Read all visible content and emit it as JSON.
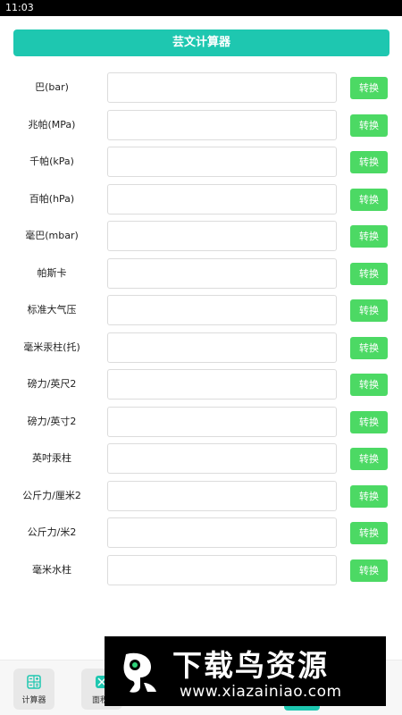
{
  "status_bar": {
    "time": "11:03"
  },
  "header": {
    "title": "芸文计算器"
  },
  "converter": {
    "button_label": "转换",
    "rows": [
      {
        "label": "巴(bar)",
        "value": ""
      },
      {
        "label": "兆帕(MPa)",
        "value": ""
      },
      {
        "label": "千帕(kPa)",
        "value": ""
      },
      {
        "label": "百帕(hPa)",
        "value": ""
      },
      {
        "label": "毫巴(mbar)",
        "value": ""
      },
      {
        "label": "帕斯卡",
        "value": ""
      },
      {
        "label": "标准大气压",
        "value": ""
      },
      {
        "label": "毫米汞柱(托)",
        "value": ""
      },
      {
        "label": "磅力/英尺2",
        "value": ""
      },
      {
        "label": "磅力/英寸2",
        "value": ""
      },
      {
        "label": "英吋汞柱",
        "value": ""
      },
      {
        "label": "公斤力/厘米2",
        "value": ""
      },
      {
        "label": "公斤力/米2",
        "value": ""
      },
      {
        "label": "毫米水柱",
        "value": ""
      }
    ]
  },
  "bottom_nav": {
    "items": [
      {
        "label": "计算器",
        "icon": "calculator-icon"
      },
      {
        "label": "面积",
        "icon": "area-icon"
      }
    ]
  },
  "watermark": {
    "title": "下载鸟资源",
    "url": "www.xiazainiao.com"
  },
  "colors": {
    "accent": "#1ec7b0",
    "button": "#4cd964"
  }
}
